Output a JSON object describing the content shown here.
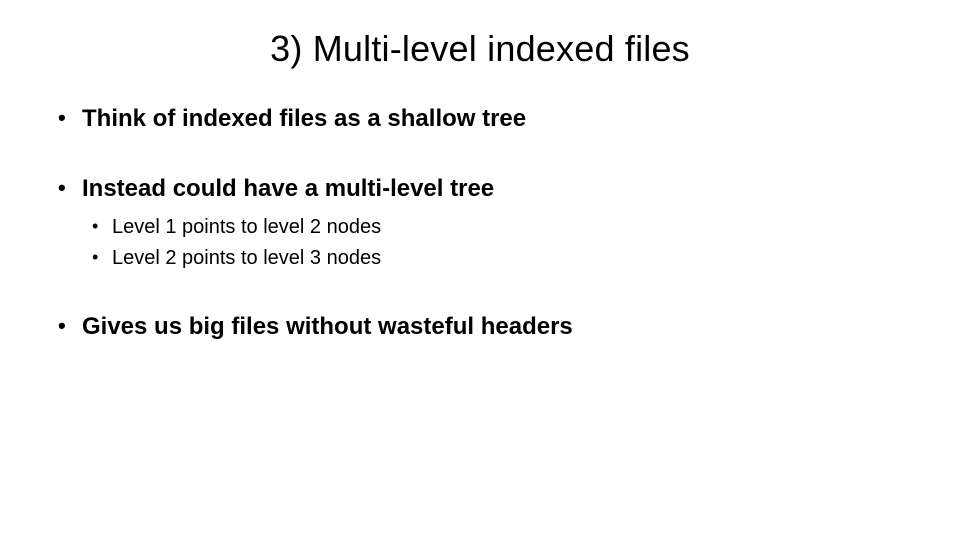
{
  "slide": {
    "title": "3) Multi-level indexed files",
    "bullets": [
      {
        "text": "Think of indexed files as a shallow tree",
        "children": []
      },
      {
        "text": "Instead could have a multi-level tree",
        "children": [
          "Level 1 points to level 2 nodes",
          "Level 2 points to level 3 nodes"
        ]
      },
      {
        "text": "Gives us big files without wasteful headers",
        "children": []
      }
    ]
  }
}
